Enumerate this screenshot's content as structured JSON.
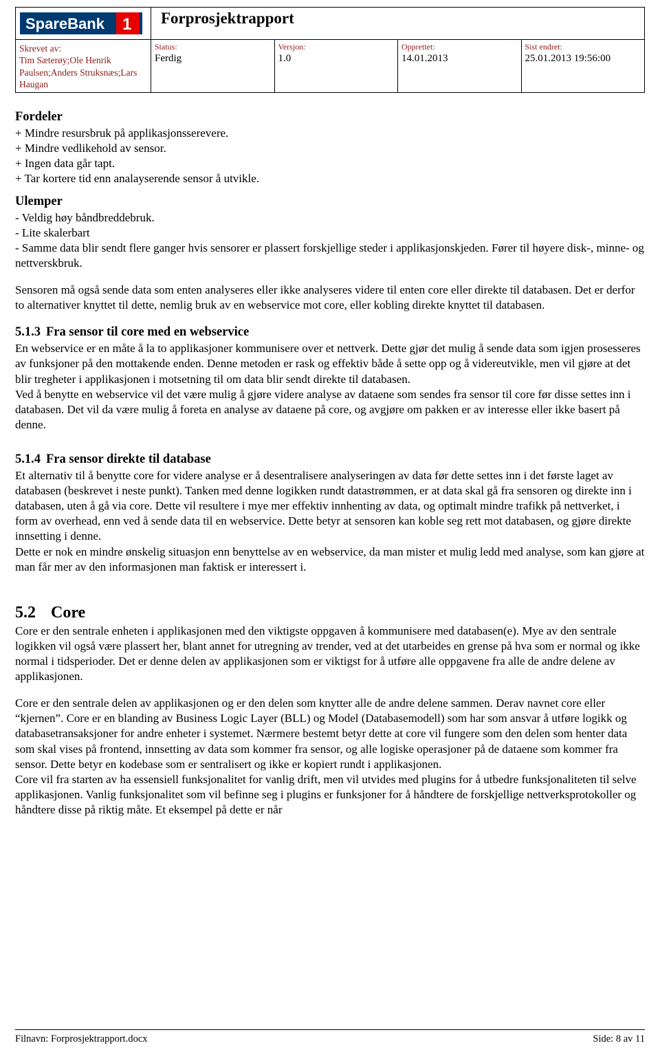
{
  "header": {
    "logo_text": "SpareBank 1",
    "logo_mark": "1",
    "title": "Forprosjektrapport",
    "author_label": "Skrevet av:",
    "author_names": "Tim Sæterøy;Ole Henrik Paulsen;Anders Struksnæs;Lars Haugan",
    "fields": [
      {
        "label": "Status:",
        "value": "Ferdig"
      },
      {
        "label": "Versjon:",
        "value": "1.0"
      },
      {
        "label": "Opprettet:",
        "value": "14.01.2013"
      },
      {
        "label": "Sist endret:",
        "value": "25.01.2013 19:56:00"
      }
    ]
  },
  "body": {
    "fordeler_heading": "Fordeler",
    "fordeler_items": [
      "+ Mindre resursbruk på applikasjonsserevere.",
      "+ Mindre vedlikehold av sensor.",
      "+ Ingen data går tapt.",
      "+ Tar kortere tid enn analayserende sensor å utvikle."
    ],
    "ulemper_heading": "Ulemper",
    "ulemper_items": [
      "- Veldig høy båndbreddebruk.",
      "- Lite skalerbart",
      "- Samme data blir sendt flere ganger hvis sensorer er plassert forskjellige steder i applikasjonskjeden. Fører til høyere disk-, minne- og nettverskbruk."
    ],
    "para_sensor": "Sensoren må også sende data som enten analyseres eller ikke analyseres videre til enten core eller direkte til databasen. Det er derfor to alternativer knyttet til dette, nemlig bruk av en webservice mot core, eller kobling direkte knyttet til databasen.",
    "sec_513_number": "5.1.3",
    "sec_513_title": "Fra sensor til core med en webservice",
    "para_513_a": "En webservice er en måte å la to applikasjoner kommunisere over et nettverk. Dette gjør det mulig å sende data som igjen prosesseres av funksjoner på den mottakende enden. Denne metoden er rask og effektiv både å sette opp og å videreutvikle, men vil gjøre at det blir tregheter i applikasjonen i motsetning til om data blir sendt direkte til databasen.",
    "para_513_b": "Ved å benytte en webservice vil det være mulig å gjøre videre analyse av dataene som sendes fra sensor til core før disse settes inn i databasen. Det vil da være mulig å foreta en analyse av dataene på core, og avgjøre om pakken er av interesse eller ikke basert på denne.",
    "sec_514_number": "5.1.4",
    "sec_514_title": "Fra sensor direkte til database",
    "para_514_a": "Et alternativ til å benytte core for videre analyse er å desentralisere analyseringen av data før dette settes inn i det første laget av databasen (beskrevet i neste punkt). Tanken med denne logikken rundt datastrømmen, er at data skal gå fra sensoren og direkte inn i databasen, uten å gå via core. Dette vil resultere i mye mer effektiv innhenting av data, og optimalt mindre trafikk på nettverket, i form av overhead, enn ved å sende data til en webservice. Dette betyr at sensoren kan koble seg rett mot databasen, og gjøre direkte innsetting i denne.",
    "para_514_b": "Dette er nok en mindre ønskelig situasjon enn benyttelse av en webservice, da man mister et mulig ledd med analyse, som kan gjøre at man får mer av den informasjonen man faktisk er interessert i.",
    "sec_52_number": "5.2",
    "sec_52_title": "Core",
    "para_52_a": "Core er den sentrale enheten i applikasjonen med den viktigste oppgaven å kommunisere med databasen(e). Mye av den sentrale logikken vil også være plassert her, blant annet for utregning av trender, ved at det utarbeides en grense på hva som er normal og ikke normal i tidsperioder. Det er denne delen av applikasjonen som er viktigst for å utføre alle oppgavene fra alle de andre delene av applikasjonen.",
    "para_52_b": "Core er den sentrale delen av applikasjonen og er den delen som knytter alle de andre delene sammen. Derav navnet core eller “kjernen”. Core er en blanding av Business Logic Layer (BLL) og Model (Databasemodell) som har som ansvar å utføre logikk og databasetransaksjoner for andre enheter i systemet. Nærmere bestemt betyr dette at core vil fungere som den delen som henter data som skal vises på frontend, innsetting av data som kommer fra sensor, og alle logiske operasjoner på de dataene som kommer fra sensor. Dette betyr en kodebase som er sentralisert og ikke er kopiert rundt i applikasjonen.",
    "para_52_c": "Core vil fra starten av ha essensiell funksjonalitet for vanlig drift, men vil utvides med plugins for å utbedre funksjonaliteten til selve applikasjonen. Vanlig funksjonalitet som vil befinne seg i plugins er funksjoner for å håndtere de forskjellige nettverksprotokoller og håndtere disse på riktig måte. Et eksempel på dette er når"
  },
  "footer": {
    "filename": "Filnavn: Forprosjektrapport.docx",
    "page": "Side: 8 av 11"
  }
}
